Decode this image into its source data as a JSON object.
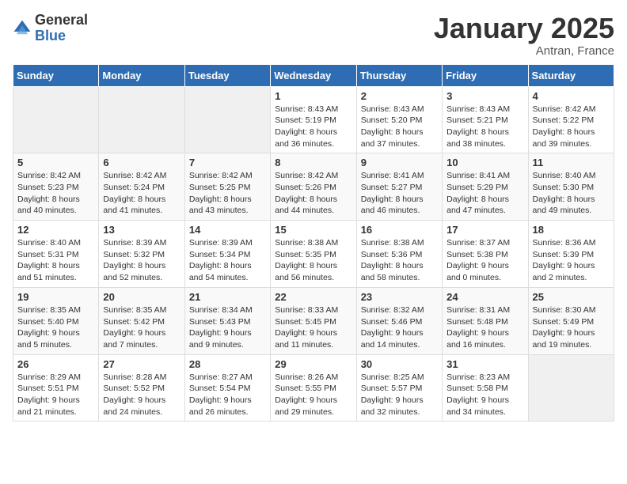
{
  "logo": {
    "general": "General",
    "blue": "Blue"
  },
  "header": {
    "month": "January 2025",
    "location": "Antran, France"
  },
  "weekdays": [
    "Sunday",
    "Monday",
    "Tuesday",
    "Wednesday",
    "Thursday",
    "Friday",
    "Saturday"
  ],
  "weeks": [
    [
      {
        "day": "",
        "info": ""
      },
      {
        "day": "",
        "info": ""
      },
      {
        "day": "",
        "info": ""
      },
      {
        "day": "1",
        "info": "Sunrise: 8:43 AM\nSunset: 5:19 PM\nDaylight: 8 hours and 36 minutes."
      },
      {
        "day": "2",
        "info": "Sunrise: 8:43 AM\nSunset: 5:20 PM\nDaylight: 8 hours and 37 minutes."
      },
      {
        "day": "3",
        "info": "Sunrise: 8:43 AM\nSunset: 5:21 PM\nDaylight: 8 hours and 38 minutes."
      },
      {
        "day": "4",
        "info": "Sunrise: 8:42 AM\nSunset: 5:22 PM\nDaylight: 8 hours and 39 minutes."
      }
    ],
    [
      {
        "day": "5",
        "info": "Sunrise: 8:42 AM\nSunset: 5:23 PM\nDaylight: 8 hours and 40 minutes."
      },
      {
        "day": "6",
        "info": "Sunrise: 8:42 AM\nSunset: 5:24 PM\nDaylight: 8 hours and 41 minutes."
      },
      {
        "day": "7",
        "info": "Sunrise: 8:42 AM\nSunset: 5:25 PM\nDaylight: 8 hours and 43 minutes."
      },
      {
        "day": "8",
        "info": "Sunrise: 8:42 AM\nSunset: 5:26 PM\nDaylight: 8 hours and 44 minutes."
      },
      {
        "day": "9",
        "info": "Sunrise: 8:41 AM\nSunset: 5:27 PM\nDaylight: 8 hours and 46 minutes."
      },
      {
        "day": "10",
        "info": "Sunrise: 8:41 AM\nSunset: 5:29 PM\nDaylight: 8 hours and 47 minutes."
      },
      {
        "day": "11",
        "info": "Sunrise: 8:40 AM\nSunset: 5:30 PM\nDaylight: 8 hours and 49 minutes."
      }
    ],
    [
      {
        "day": "12",
        "info": "Sunrise: 8:40 AM\nSunset: 5:31 PM\nDaylight: 8 hours and 51 minutes."
      },
      {
        "day": "13",
        "info": "Sunrise: 8:39 AM\nSunset: 5:32 PM\nDaylight: 8 hours and 52 minutes."
      },
      {
        "day": "14",
        "info": "Sunrise: 8:39 AM\nSunset: 5:34 PM\nDaylight: 8 hours and 54 minutes."
      },
      {
        "day": "15",
        "info": "Sunrise: 8:38 AM\nSunset: 5:35 PM\nDaylight: 8 hours and 56 minutes."
      },
      {
        "day": "16",
        "info": "Sunrise: 8:38 AM\nSunset: 5:36 PM\nDaylight: 8 hours and 58 minutes."
      },
      {
        "day": "17",
        "info": "Sunrise: 8:37 AM\nSunset: 5:38 PM\nDaylight: 9 hours and 0 minutes."
      },
      {
        "day": "18",
        "info": "Sunrise: 8:36 AM\nSunset: 5:39 PM\nDaylight: 9 hours and 2 minutes."
      }
    ],
    [
      {
        "day": "19",
        "info": "Sunrise: 8:35 AM\nSunset: 5:40 PM\nDaylight: 9 hours and 5 minutes."
      },
      {
        "day": "20",
        "info": "Sunrise: 8:35 AM\nSunset: 5:42 PM\nDaylight: 9 hours and 7 minutes."
      },
      {
        "day": "21",
        "info": "Sunrise: 8:34 AM\nSunset: 5:43 PM\nDaylight: 9 hours and 9 minutes."
      },
      {
        "day": "22",
        "info": "Sunrise: 8:33 AM\nSunset: 5:45 PM\nDaylight: 9 hours and 11 minutes."
      },
      {
        "day": "23",
        "info": "Sunrise: 8:32 AM\nSunset: 5:46 PM\nDaylight: 9 hours and 14 minutes."
      },
      {
        "day": "24",
        "info": "Sunrise: 8:31 AM\nSunset: 5:48 PM\nDaylight: 9 hours and 16 minutes."
      },
      {
        "day": "25",
        "info": "Sunrise: 8:30 AM\nSunset: 5:49 PM\nDaylight: 9 hours and 19 minutes."
      }
    ],
    [
      {
        "day": "26",
        "info": "Sunrise: 8:29 AM\nSunset: 5:51 PM\nDaylight: 9 hours and 21 minutes."
      },
      {
        "day": "27",
        "info": "Sunrise: 8:28 AM\nSunset: 5:52 PM\nDaylight: 9 hours and 24 minutes."
      },
      {
        "day": "28",
        "info": "Sunrise: 8:27 AM\nSunset: 5:54 PM\nDaylight: 9 hours and 26 minutes."
      },
      {
        "day": "29",
        "info": "Sunrise: 8:26 AM\nSunset: 5:55 PM\nDaylight: 9 hours and 29 minutes."
      },
      {
        "day": "30",
        "info": "Sunrise: 8:25 AM\nSunset: 5:57 PM\nDaylight: 9 hours and 32 minutes."
      },
      {
        "day": "31",
        "info": "Sunrise: 8:23 AM\nSunset: 5:58 PM\nDaylight: 9 hours and 34 minutes."
      },
      {
        "day": "",
        "info": ""
      }
    ]
  ]
}
